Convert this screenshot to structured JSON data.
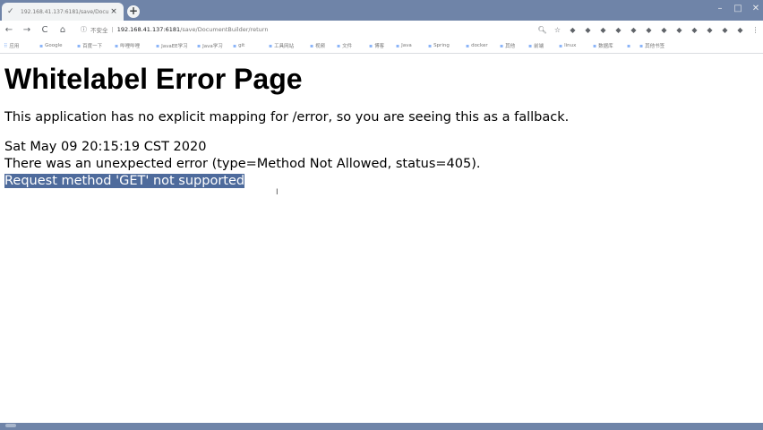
{
  "browser": {
    "tab_title": "192.168.41.137:6181/save/Docu...",
    "new_tab_label": "+",
    "window_controls": {
      "minimize": "–",
      "maximize": "□",
      "close": "✕"
    },
    "nav": {
      "back": "←",
      "forward": "→",
      "reload": "C",
      "home": "⌂"
    },
    "address": {
      "security": "不安全",
      "host": "192.168.41.137:6181",
      "path": "/save/DocumentBuilder/return"
    },
    "extensions": [
      "search-icon",
      "star-icon",
      "ext-icon",
      "ext-icon",
      "ext-icon",
      "ext-icon",
      "ext-icon",
      "ext-icon",
      "ext-icon",
      "ext-icon",
      "ext-icon",
      "ext-icon",
      "ext-icon",
      "ext-icon",
      "menu-icon"
    ],
    "bookmarks": [
      {
        "label": "应用"
      },
      {
        "label": "Google"
      },
      {
        "label": "百度一下"
      },
      {
        "label": "哔哩哔哩"
      },
      {
        "label": "JavaEE学习"
      },
      {
        "label": "Java学习"
      },
      {
        "label": "git"
      },
      {
        "label": "工具网站"
      },
      {
        "label": "视频"
      },
      {
        "label": "文件"
      },
      {
        "label": "博客"
      },
      {
        "label": "Java"
      },
      {
        "label": "Spring"
      },
      {
        "label": "docker"
      },
      {
        "label": "其他"
      },
      {
        "label": "前端"
      },
      {
        "label": "linux"
      },
      {
        "label": "数据库"
      },
      {
        "label": ""
      },
      {
        "label": "其他书签"
      }
    ]
  },
  "page": {
    "heading": "Whitelabel Error Page",
    "message": "This application has no explicit mapping for /error, so you are seeing this as a fallback.",
    "timestamp": "Sat May 09 20:15:19 CST 2020",
    "error_line": "There was an unexpected error (type=Method Not Allowed, status=405).",
    "detail": "Request method 'GET' not supported"
  },
  "colors": {
    "tabstrip": "#6f84a8",
    "selection": "#4e6b9c"
  }
}
